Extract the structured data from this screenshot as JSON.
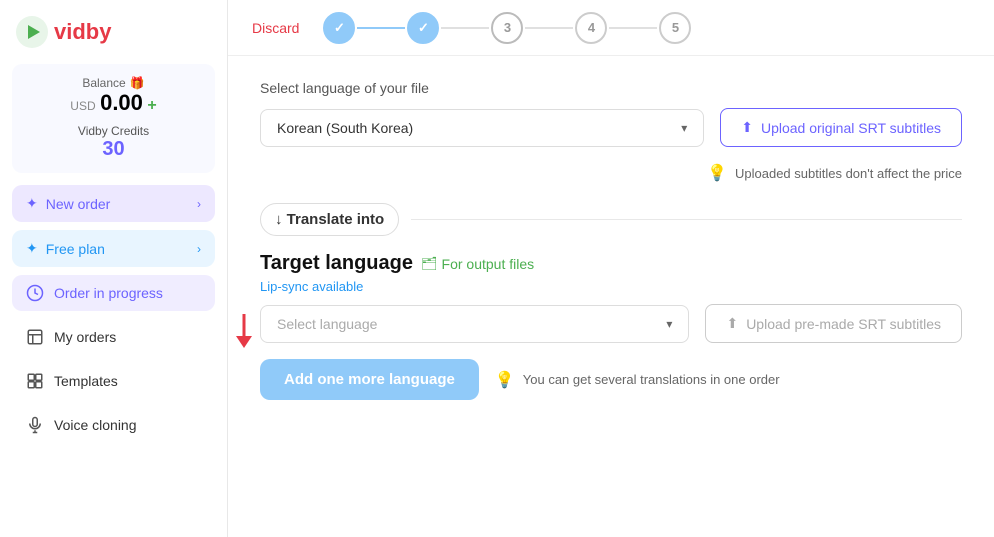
{
  "sidebar": {
    "logo_text": "vidby",
    "balance": {
      "title": "Balance",
      "currency": "USD",
      "amount": "0.00",
      "add": "+",
      "credits_title": "Vidby Credits",
      "credits_amount": "30"
    },
    "nav": [
      {
        "id": "new-order",
        "label": "New order",
        "active": false,
        "has_chevron": true
      },
      {
        "id": "free-plan",
        "label": "Free plan",
        "active": false,
        "has_chevron": true
      }
    ],
    "items": [
      {
        "id": "order-in-progress",
        "label": "Order in progress",
        "active": true
      },
      {
        "id": "my-orders",
        "label": "My orders",
        "active": false
      },
      {
        "id": "templates",
        "label": "Templates",
        "active": false
      },
      {
        "id": "voice-cloning",
        "label": "Voice cloning",
        "active": false
      }
    ]
  },
  "header": {
    "discard_label": "Discard",
    "steps": [
      {
        "id": 1,
        "label": "✓",
        "state": "done"
      },
      {
        "id": 2,
        "label": "✓",
        "state": "done"
      },
      {
        "id": 3,
        "label": "3",
        "state": "current"
      },
      {
        "id": 4,
        "label": "4",
        "state": "future"
      },
      {
        "id": 5,
        "label": "5",
        "state": "future"
      }
    ]
  },
  "main": {
    "file_language_label": "Select language of your file",
    "file_language_value": "Korean (South Korea)",
    "file_language_placeholder": "Korean (South Korea)",
    "upload_srt_label": "Upload original SRT subtitles",
    "hint_subtitle": "Uploaded subtitles don't affect the price",
    "translate_into_label": "↓  Translate into",
    "target_language_title": "Target language",
    "for_output_label": "For output files",
    "lip_sync_label": "Lip-sync available",
    "select_language_placeholder": "Select language",
    "upload_premade_label": "Upload pre-made SRT subtitles",
    "add_language_btn": "Add one more language",
    "hint_translations": "You can get several translations in one order"
  }
}
